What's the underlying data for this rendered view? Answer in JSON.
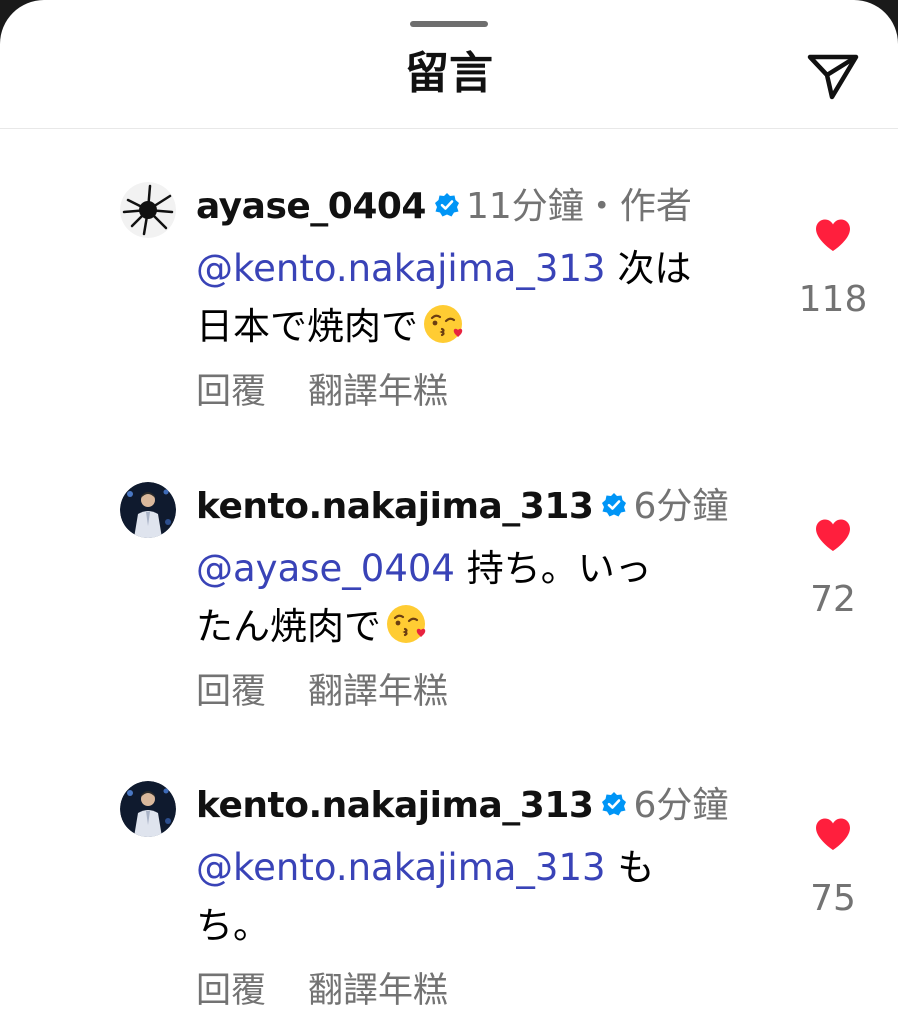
{
  "sheet": {
    "title": "留言",
    "share_icon": "paper-plane-icon"
  },
  "colors": {
    "mention": "#3943b7",
    "muted": "#737373",
    "like": "#ff1f3d",
    "verified": "#0095f6"
  },
  "comments": [
    {
      "username": "ayase_0404",
      "verified": true,
      "time": "11分鐘",
      "separator": "・",
      "author_label": "作者",
      "mention": "@kento.nakajima_313",
      "text_line1": " 次は",
      "text_line2": "日本で焼肉で",
      "emoji": "kissing-heart-emoji",
      "reply": "回覆",
      "translate": "翻譯年糕",
      "likes": "118"
    },
    {
      "username": "kento.nakajima_313",
      "verified": true,
      "time": "6分鐘",
      "mention": "@ayase_0404",
      "text_line1": " 持ち。いっ",
      "text_line2": "たん焼肉で",
      "emoji": "kissing-heart-emoji",
      "reply": "回覆",
      "translate": "翻譯年糕",
      "likes": "72"
    },
    {
      "username": "kento.nakajima_313",
      "verified": true,
      "time": "6分鐘",
      "mention": "@kento.nakajima_313",
      "text_line1": " も",
      "text_line2": "ち。",
      "reply": "回覆",
      "translate": "翻譯年糕",
      "likes": "75"
    }
  ]
}
